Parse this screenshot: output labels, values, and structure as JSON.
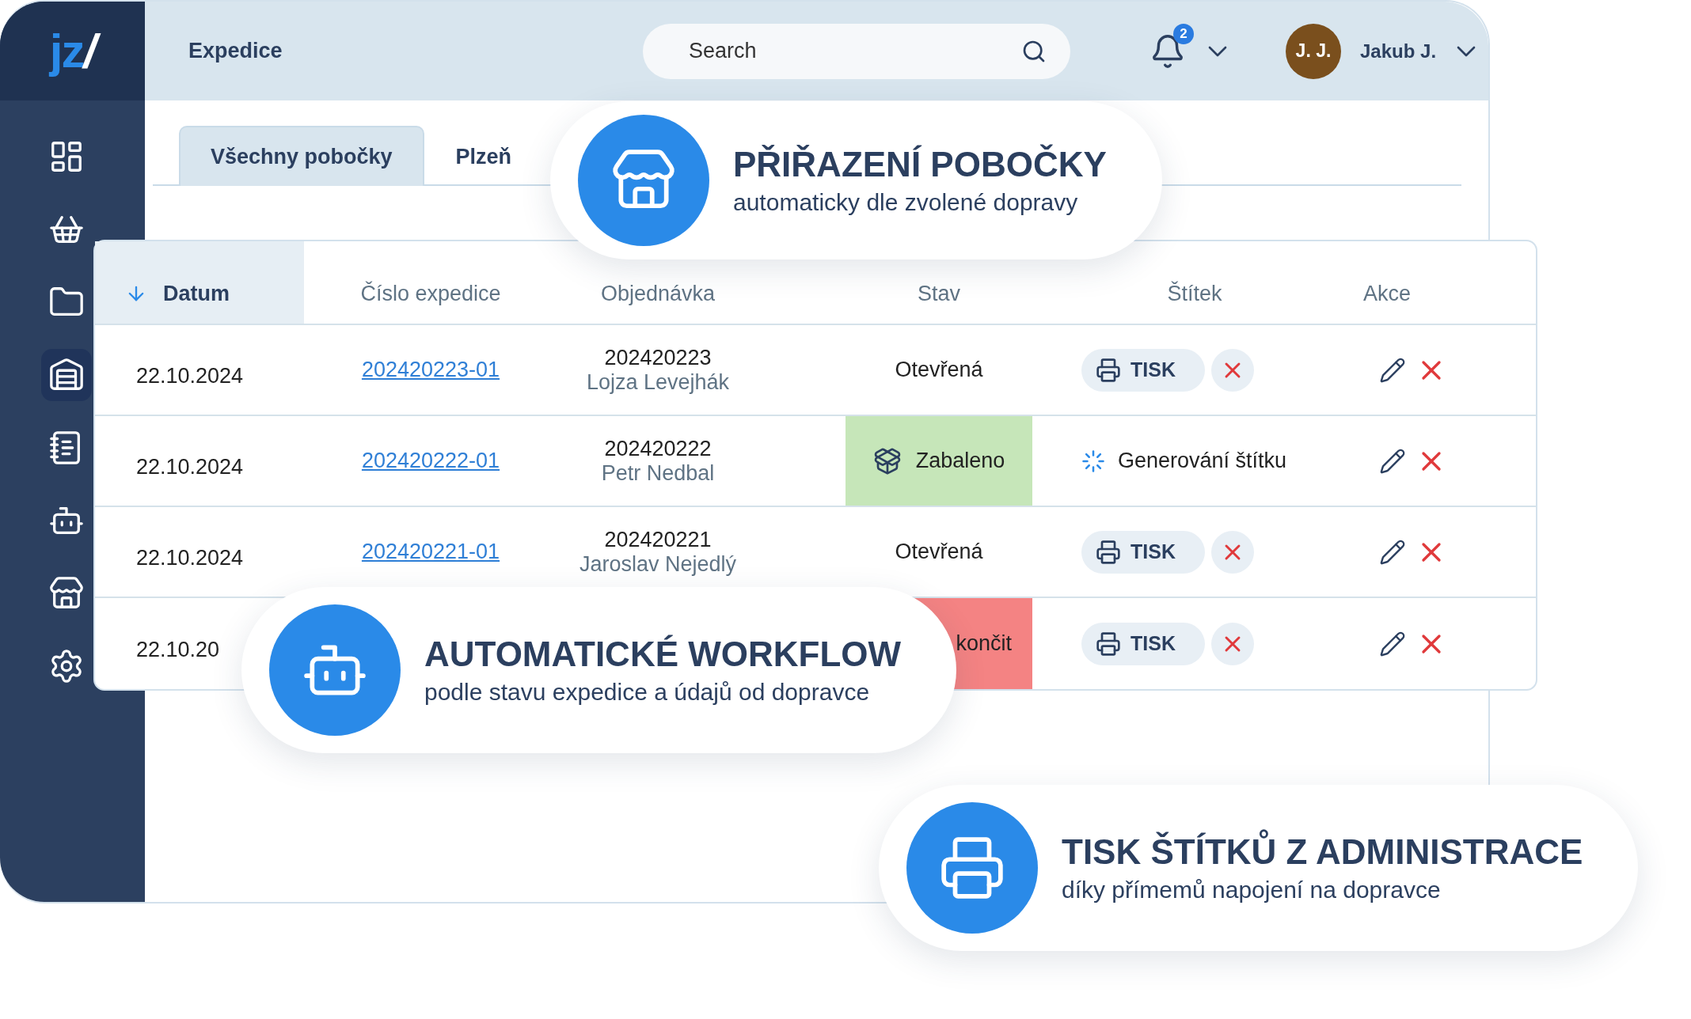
{
  "logo": {
    "letters": "jz",
    "slash": "/"
  },
  "page_title": "Expedice",
  "search": {
    "placeholder": "Search"
  },
  "notifications": {
    "count": "2"
  },
  "user": {
    "initials": "J. J.",
    "name": "Jakub J."
  },
  "sidebar": {
    "items": [
      {
        "kind": "dashboard",
        "selected": false
      },
      {
        "kind": "basket",
        "selected": false
      },
      {
        "kind": "folder",
        "selected": false
      },
      {
        "kind": "warehouse",
        "selected": true
      },
      {
        "kind": "notebook",
        "selected": false
      },
      {
        "kind": "robot",
        "selected": false
      },
      {
        "kind": "store",
        "selected": false
      },
      {
        "kind": "settings",
        "selected": false
      }
    ]
  },
  "tabs": [
    {
      "label": "Všechny pobočky",
      "selected": true
    },
    {
      "label": "Plzeň",
      "selected": false
    }
  ],
  "table": {
    "columns": [
      {
        "label": "Datum",
        "sorted": true
      },
      {
        "label": "Číslo expedice",
        "sorted": false
      },
      {
        "label": "Objednávka",
        "sorted": false
      },
      {
        "label": "Stav",
        "sorted": false
      },
      {
        "label": "Štítek",
        "sorted": false
      },
      {
        "label": "Akce",
        "sorted": false
      }
    ],
    "rows": [
      {
        "date": "22.10.2024",
        "shipment": "202420223-01",
        "order": "202420223",
        "customer": "Lojza Levejhák",
        "status": {
          "kind": "open",
          "text": "Otevřená"
        },
        "label": {
          "kind": "print",
          "text": "TISK"
        }
      },
      {
        "date": "22.10.2024",
        "shipment": "202420222-01",
        "order": "202420222",
        "customer": "Petr Nedbal",
        "status": {
          "kind": "packed",
          "text": "Zabaleno"
        },
        "label": {
          "kind": "generating",
          "text": "Generování štítku"
        }
      },
      {
        "date": "22.10.2024",
        "shipment": "202420221-01",
        "order": "202420221",
        "customer": "Jaroslav Nejedlý",
        "status": {
          "kind": "open",
          "text": "Otevřená"
        },
        "label": {
          "kind": "print",
          "text": "TISK"
        }
      },
      {
        "date": "22.10.20",
        "status": {
          "kind": "error",
          "text": "končit"
        },
        "label": {
          "kind": "print",
          "text": "TISK"
        }
      }
    ]
  },
  "callouts": [
    {
      "kind": "store",
      "title": "PŘIŘAZENÍ POBOČKY",
      "subtitle": "automaticky dle zvolené dopravy"
    },
    {
      "kind": "robot",
      "title": "AUTOMATICKÉ WORKFLOW",
      "subtitle": "podle stavu expedice a údajů od dopravce"
    },
    {
      "kind": "printer",
      "title": "TISK ŠTÍTKŮ Z ADMINISTRACE",
      "subtitle": "díky přímemů napojení na dopravce"
    }
  ]
}
